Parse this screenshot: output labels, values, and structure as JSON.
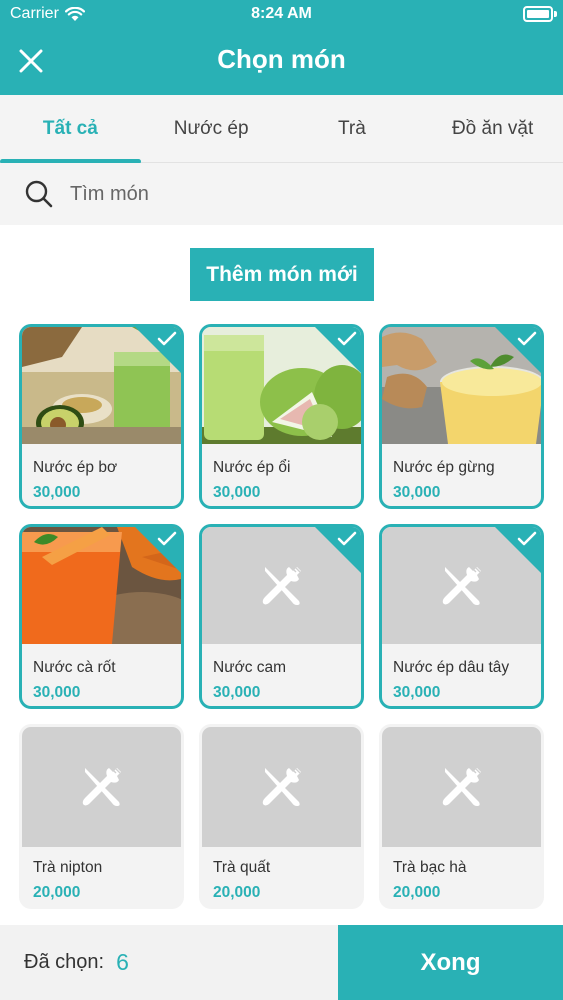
{
  "status_bar": {
    "carrier": "Carrier",
    "time": "8:24 AM"
  },
  "header": {
    "title": "Chọn món",
    "close_icon": "close-icon"
  },
  "tabs": [
    {
      "label": "Tất cả",
      "active": true
    },
    {
      "label": "Nước ép",
      "active": false
    },
    {
      "label": "Trà",
      "active": false
    },
    {
      "label": "Đồ ăn vặt",
      "active": false
    }
  ],
  "search": {
    "placeholder": "Tìm món",
    "icon": "search-icon"
  },
  "add_button": {
    "label": "Thêm món mới"
  },
  "items": [
    {
      "name": "Nước ép bơ",
      "price": "30,000",
      "selected": true,
      "image": "avocado-juice-photo"
    },
    {
      "name": "Nước ép ổi",
      "price": "30,000",
      "selected": true,
      "image": "guava-juice-photo"
    },
    {
      "name": "Nước ép gừng",
      "price": "30,000",
      "selected": true,
      "image": "ginger-juice-photo"
    },
    {
      "name": "Nước cà rốt",
      "price": "30,000",
      "selected": true,
      "image": "carrot-juice-photo"
    },
    {
      "name": "Nước cam",
      "price": "30,000",
      "selected": true,
      "image": "placeholder"
    },
    {
      "name": "Nước ép dâu tây",
      "price": "30,000",
      "selected": true,
      "image": "placeholder"
    },
    {
      "name": "Trà nipton",
      "price": "20,000",
      "selected": false,
      "image": "placeholder"
    },
    {
      "name": "Trà quất",
      "price": "20,000",
      "selected": false,
      "image": "placeholder"
    },
    {
      "name": "Trà bạc hà",
      "price": "20,000",
      "selected": false,
      "image": "placeholder"
    }
  ],
  "footer": {
    "selected_label": "Đã chọn:",
    "selected_count": "6",
    "done_label": "Xong"
  },
  "colors": {
    "accent": "#29b1b5",
    "tab_bg": "#f4f4f4",
    "placeholder_bg": "#d0d0d0"
  }
}
